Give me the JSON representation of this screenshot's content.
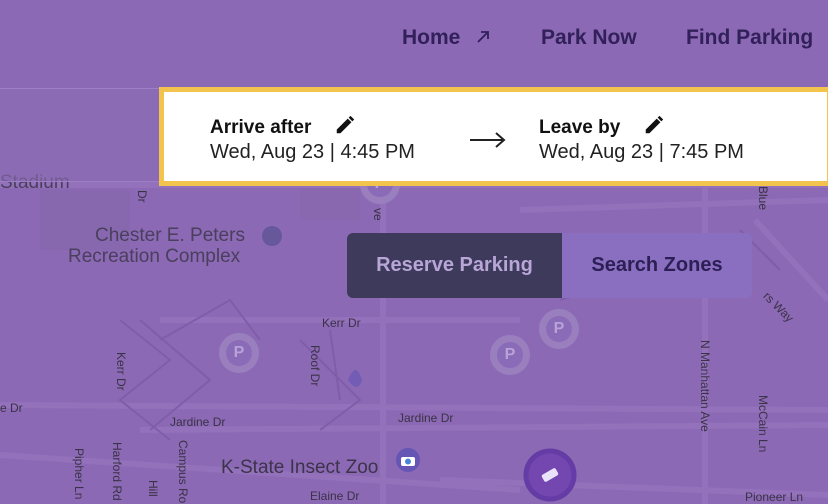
{
  "nav": {
    "home": "Home",
    "home_icon": "external-link-icon",
    "park_now": "Park Now",
    "find_parking": "Find Parking"
  },
  "time": {
    "arrive_label": "Arrive after",
    "arrive_value": "Wed, Aug 23 | 4:45 PM",
    "leave_label": "Leave by",
    "leave_value": "Wed, Aug 23 | 7:45 PM",
    "edit_icon": "pencil-icon",
    "arrow_icon": "right-arrow-icon"
  },
  "toggle": {
    "reserve": "Reserve Parking",
    "search": "Search Zones"
  },
  "map": {
    "labels": {
      "stadium": "Stadium",
      "chester": "Chester E. Peters",
      "recreation": "Recreation Complex",
      "kerr_dr_1": "Kerr Dr",
      "kerr_dr_2": "Kerr Dr",
      "roof_dr": "Roof Dr",
      "e_dr": "e Dr",
      "jardine_1": "Jardine Dr",
      "jardine_2": "Jardine Dr",
      "insect_zoo": "K-State Insect Zoo",
      "elaine": "Elaine Dr",
      "manhattan": "N Manhattan Ave",
      "mccain": "McCain Ln",
      "pioneer": "Pioneer Ln",
      "pipher": "Pipher Ln",
      "harford": "Harford Rd",
      "campus": "Campus Ro",
      "hill": "Hill",
      "ve": "ve",
      "dr_top": "Dr",
      "blue": "Blue",
      "rs_way": "rs Way",
      "parking_pin_letter": "P"
    },
    "colors": {
      "overlay": "#7042a8",
      "accent_border": "#f2c44e",
      "toggle_active": "#3d3a5c"
    }
  }
}
